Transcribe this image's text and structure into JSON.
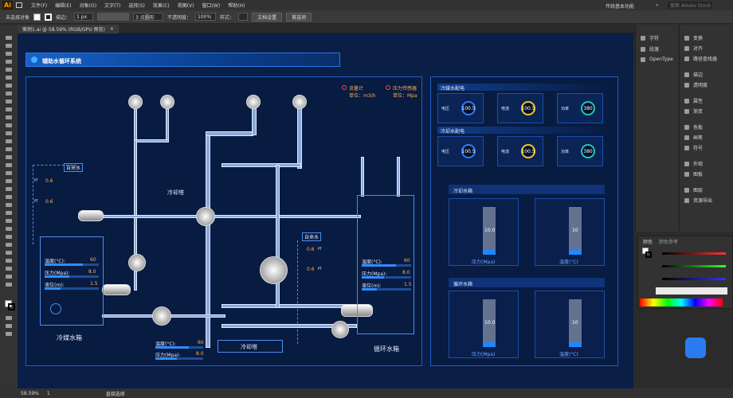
{
  "app": {
    "logo": "Ai"
  },
  "menu": [
    "文件(F)",
    "编辑(E)",
    "对象(O)",
    "文字(T)",
    "选择(S)",
    "效果(C)",
    "视图(V)",
    "窗口(W)",
    "帮助(H)"
  ],
  "menu_right": {
    "workspace": "传统基本功能",
    "search": "搜索 Adobe Stock"
  },
  "control": {
    "no_selection": "未选择对象",
    "stroke_label": "描边：",
    "stroke_value": "1 px",
    "brush": "3 点圆形",
    "opacity_label": "不透明度：",
    "opacity_value": "100%",
    "style_label": "样式：",
    "doc_setup": "文档设置",
    "prefs": "首选项"
  },
  "tab": {
    "label": "案例1.ai @ 58.59% (RGB/GPU 预览)",
    "close": "×"
  },
  "panels_left": [
    {
      "label": "字符"
    },
    {
      "label": "段落"
    },
    {
      "label": "OpenType"
    }
  ],
  "panels_right": [
    {
      "label": "变换"
    },
    {
      "label": "对齐"
    },
    {
      "label": "路径查找器"
    },
    {
      "label": "描边"
    },
    {
      "label": "透明度"
    },
    {
      "label": "属性"
    },
    {
      "label": "渐变"
    },
    {
      "label": "色板"
    },
    {
      "label": "画笔"
    },
    {
      "label": "符号"
    },
    {
      "label": "外观"
    },
    {
      "label": "图板"
    },
    {
      "label": "图层"
    },
    {
      "label": "资源导出"
    }
  ],
  "color_panel": {
    "tab1": "颜色",
    "tab2": "颜色参考"
  },
  "status": {
    "zoom": "58.59%",
    "page": "1",
    "tool": "直接选择"
  },
  "scada": {
    "title": "辅助水循环系统",
    "legend": {
      "flow": "流量计",
      "flow_unit": "单位：m3/h",
      "pressure": "压力传感器",
      "pressure_unit": "单位：Mpa"
    },
    "cooling_tower": "冷却塔",
    "tap_water_1": "自来水",
    "tap_water_2": "自来水",
    "pt_values": [
      "0.6",
      "0.6",
      "0.6",
      "0.6"
    ],
    "pt_tag": "PT",
    "cold_tank": {
      "label": "冷媒水箱",
      "temp_label": "温度(°C):",
      "temp": "60",
      "pressure_label": "压力(Mpa):",
      "pressure": "8.0",
      "level_label": "液位(m):",
      "level": "1.5"
    },
    "cycle_tank": {
      "label": "循环水箱",
      "temp_label": "温度(°C):",
      "temp": "60",
      "pressure_label": "压力(Mpa):",
      "pressure": "8.0",
      "level_label": "液位(m):",
      "level": "1.5"
    },
    "tower_box": {
      "label": "冷却塔",
      "temp_label": "温度(°C):",
      "temp": "60",
      "pressure_label": "压力(Mpa):",
      "pressure": "8.0"
    },
    "chilled_section": {
      "title": "冷媒水配电",
      "cards": [
        {
          "label": "电压",
          "value": "100.5"
        },
        {
          "label": "电流",
          "value": "100.5"
        },
        {
          "label": "功率",
          "value": "380"
        }
      ]
    },
    "cooling_section": {
      "title": "冷却水配电",
      "cards": [
        {
          "label": "电压",
          "value": "100.5"
        },
        {
          "label": "电流",
          "value": "100.5"
        },
        {
          "label": "功率",
          "value": "380"
        }
      ]
    },
    "cooling_tank_section": {
      "title": "冷却水箱",
      "gauges": [
        {
          "label": "压力(Mpa)",
          "value": "10.0",
          "level": 0.1
        },
        {
          "label": "温度(°C)",
          "value": "10",
          "level": 0.1
        }
      ]
    },
    "cycle_tank_section": {
      "title": "循环水箱",
      "gauges": [
        {
          "label": "压力(Mpa)",
          "value": "10.0",
          "level": 0.1
        },
        {
          "label": "温度(°C)",
          "value": "10",
          "level": 0.1
        }
      ]
    },
    "colors": {
      "blue": "#2f7bf6",
      "yellow": "#f3c623",
      "teal": "#1ec8b4"
    }
  }
}
